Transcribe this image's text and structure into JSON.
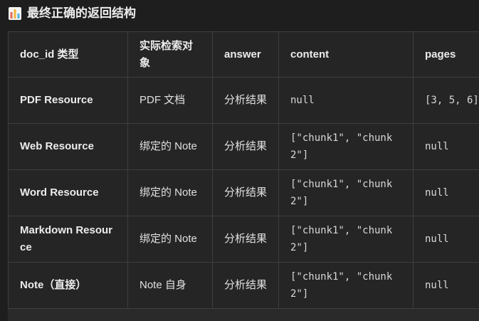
{
  "heading": {
    "icon": "bar-chart-icon",
    "title": "最终正确的返回结构"
  },
  "table": {
    "headers": [
      "doc_id 类型",
      "实际检索对象",
      "answer",
      "content",
      "pages"
    ],
    "rows": [
      [
        "PDF Resource",
        "PDF 文档",
        "分析结果",
        "null",
        "[3, 5, 6]"
      ],
      [
        "Web Resource",
        "绑定的 Note",
        "分析结果",
        "[\"chunk1\", \"chunk2\"]",
        "null"
      ],
      [
        "Word Resource",
        "绑定的 Note",
        "分析结果",
        "[\"chunk1\", \"chunk2\"]",
        "null"
      ],
      [
        "Markdown Resource",
        "绑定的 Note",
        "分析结果",
        "[\"chunk1\", \"chunk2\"]",
        "null"
      ],
      [
        "Note（直接）",
        "Note 自身",
        "分析结果",
        "[\"chunk1\", \"chunk2\"]",
        "null"
      ]
    ]
  },
  "colors": {
    "background": "#1e1e1e",
    "table_background": "#252525",
    "border": "#3e3e3e",
    "icon_bars": [
      "#e36b5c",
      "#f2b63c",
      "#4fb3e8",
      "#58c48a"
    ]
  }
}
